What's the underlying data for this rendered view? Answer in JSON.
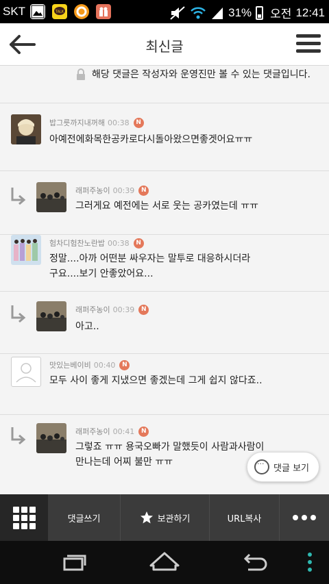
{
  "status_bar": {
    "carrier": "SKT",
    "battery": "31%",
    "ampm": "오전",
    "time": "12:41",
    "icons": [
      "gallery-icon",
      "kakaotalk-icon",
      "orange-app-icon",
      "gift-icon",
      "mute-icon",
      "wifi-icon",
      "signal-icon",
      "battery-icon"
    ]
  },
  "app_bar": {
    "title": "최신글",
    "back_icon": "arrow-left-icon",
    "menu_icon": "hamburger-menu-icon"
  },
  "comments": [
    {
      "type": "partial",
      "text": "해당 댓글은 작성자와 운영진만 볼 수 있는 댓글입니다.",
      "icon": "lock-icon"
    },
    {
      "type": "comment",
      "author": "밥그릇까지내꺼해",
      "time": "00:38",
      "badge": "N",
      "text": "아예전에화목한공카로다시돌아왔으면좋겟어요ㅠㅠ"
    },
    {
      "type": "reply",
      "author": "래퍼주농이",
      "time": "00:39",
      "badge": "N",
      "text": "그러게요 예전에는 서로 웃는 공카였는데 ㅠㅠ"
    },
    {
      "type": "comment",
      "author": "험차디험찬노란밥",
      "time": "00:38",
      "badge": "N",
      "text": "정말....아까 어떤분 싸우자는 말투로 대응하시더라구요....보기 안좋았어요..."
    },
    {
      "type": "reply",
      "author": "래퍼주농이",
      "time": "00:39",
      "badge": "N",
      "text": "아고.."
    },
    {
      "type": "comment",
      "author": "맛있는베이비",
      "time": "00:40",
      "badge": "N",
      "text": "모두 사이 좋게 지냈으면 좋겠는데 그게 쉽지 않다죠..",
      "avatar": "default-profile-icon"
    },
    {
      "type": "reply",
      "author": "래퍼주농이",
      "time": "00:41",
      "badge": "N",
      "text": "그렇죠 ㅠㅠ 용국오빠가 말했듯이 사람과사람이 만나는데 어찌 불만 ㅠㅠ"
    }
  ],
  "float_button": {
    "label": "댓글 보기"
  },
  "toolbar": {
    "write_comment": "댓글쓰기",
    "bookmark": "보관하기",
    "copy_url": "URL복사"
  },
  "colors": {
    "badge": "#e4785a",
    "toolbar": "#3b3b3b",
    "background": "#f4f4f4"
  }
}
